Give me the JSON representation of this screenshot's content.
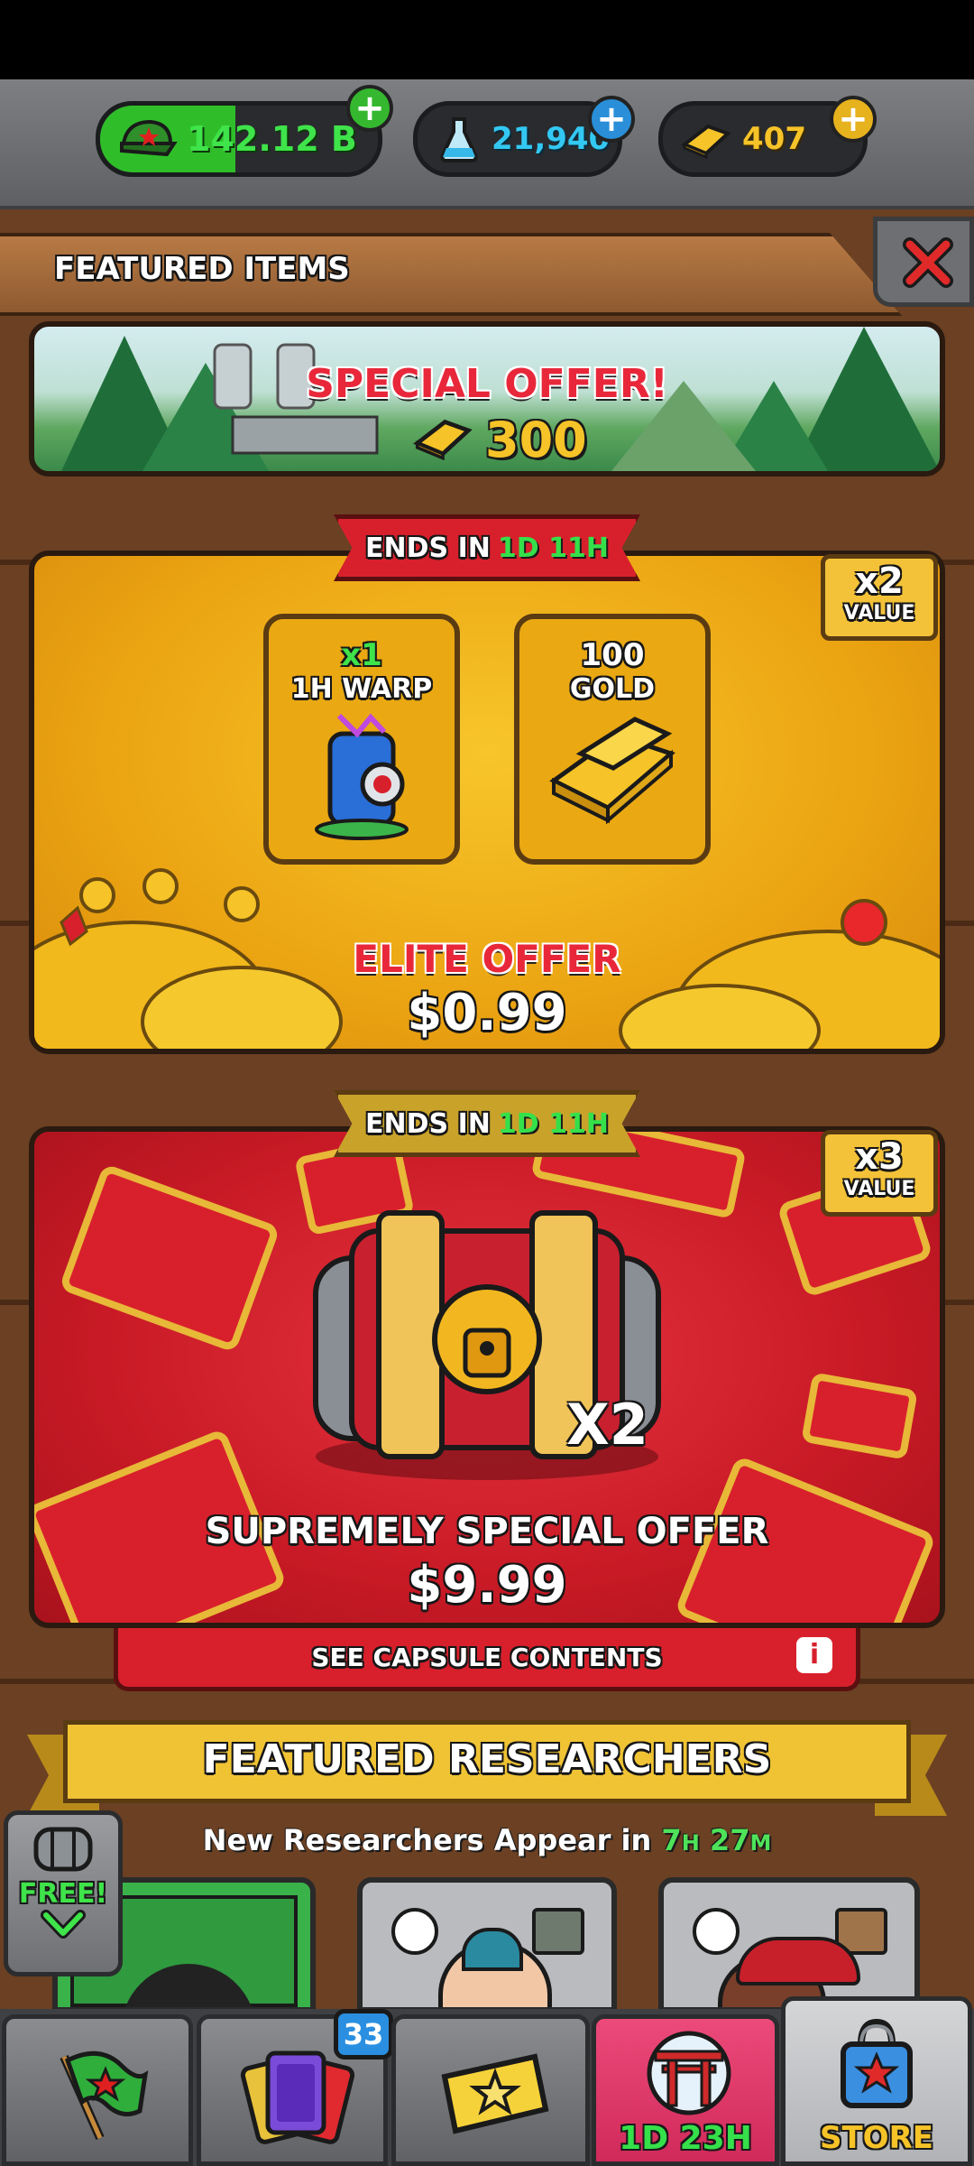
{
  "currencies": {
    "cash": "142.12 B",
    "science": "21,940",
    "gold": "407"
  },
  "header": {
    "title": "FEATURED ITEMS"
  },
  "banner": {
    "title": "SPECIAL OFFER!",
    "amount": "300"
  },
  "elite_offer": {
    "ends_prefix": "ENDS IN",
    "ends_time": "1D 11H",
    "value_mult": "x2",
    "value_label": "VALUE",
    "items": [
      {
        "qty": "x1",
        "name": "1H WARP"
      },
      {
        "qty": "100",
        "name": "GOLD"
      }
    ],
    "title": "ELITE OFFER",
    "price": "$0.99"
  },
  "supreme_offer": {
    "ends_prefix": "ENDS IN",
    "ends_time": "1D 11H",
    "value_mult": "x3",
    "value_label": "VALUE",
    "capsule_count": "X2",
    "title": "SUPREMELY SPECIAL OFFER",
    "price": "$9.99",
    "contents_button": "SEE CAPSULE CONTENTS",
    "info_glyph": "i"
  },
  "researchers": {
    "title": "FEATURED RESEARCHERS",
    "refresh_prefix": "New Researchers Appear in",
    "refresh_h": "7",
    "refresh_h_unit": "H",
    "refresh_m": "27",
    "refresh_m_unit": "M"
  },
  "free_badge": {
    "label": "FREE!"
  },
  "nav": {
    "cards_badge": "33",
    "event_timer": "1D 23H",
    "store_label": "STORE"
  },
  "colors": {
    "cash_green": "#2fbe2a",
    "science_blue": "#29c6f0",
    "gold_yellow": "#f6c328",
    "timer_green": "#35e04a",
    "offer_red": "#d8202c",
    "store_pink": "#e8356c"
  },
  "icons": [
    "cap-icon",
    "flask-icon",
    "gold-bar-icon",
    "plus-icon",
    "close-icon",
    "warp-backpack-icon",
    "gold-ingots-icon",
    "capsule-chest-icon",
    "info-icon",
    "flag-icon",
    "cards-icon",
    "ticket-star-icon",
    "torii-gate-icon",
    "shopping-bag-icon",
    "barrel-icon",
    "chevron-down-icon"
  ]
}
